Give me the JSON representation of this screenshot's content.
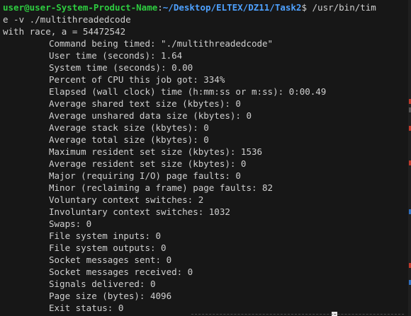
{
  "prompt": {
    "user_host": "user@user-System-Product-Name",
    "separator": ":",
    "path": "~/Desktop/ELTEX/DZ11/Task2",
    "symbol": "$ ",
    "command_part1": "/usr/bin/tim",
    "command_part2": "e -v ./multithreadedcode"
  },
  "program_output": "with race, a = 54472542",
  "time_report": [
    "Command being timed: \"./multithreadedcode\"",
    "User time (seconds): 1.64",
    "System time (seconds): 0.00",
    "Percent of CPU this job got: 334%",
    "Elapsed (wall clock) time (h:mm:ss or m:ss): 0:00.49",
    "Average shared text size (kbytes): 0",
    "Average unshared data size (kbytes): 0",
    "Average stack size (kbytes): 0",
    "Average total size (kbytes): 0",
    "Maximum resident set size (kbytes): 1536",
    "Average resident set size (kbytes): 0",
    "Major (requiring I/O) page faults: 0",
    "Minor (reclaiming a frame) page faults: 82",
    "Voluntary context switches: 2",
    "Involuntary context switches: 1032",
    "Swaps: 0",
    "File system inputs: 0",
    "File system outputs: 0",
    "Socket messages sent: 0",
    "Socket messages received: 0",
    "Signals delivered: 0",
    "Page size (bytes): 4096",
    "Exit status: 0"
  ],
  "colors": {
    "background": "#171717",
    "text": "#d0d0d0",
    "user_host": "#2ecc40",
    "path": "#4ea1ff"
  }
}
